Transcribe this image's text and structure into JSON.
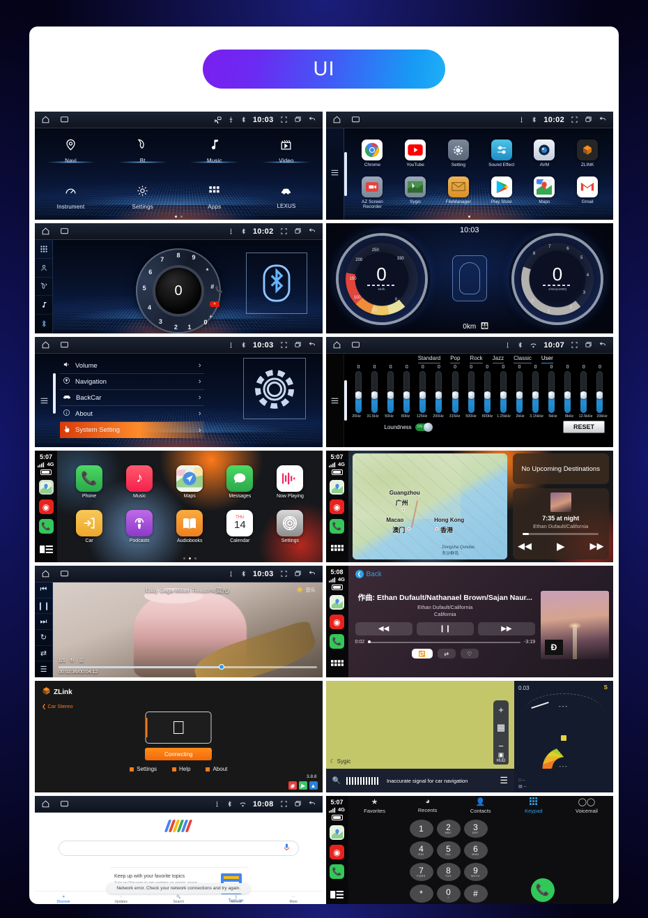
{
  "header": {
    "title": "UI"
  },
  "panels": {
    "home": {
      "statusbar": {
        "time": "10:03",
        "icons": [
          "home-icon",
          "screen-icon",
          "cast-icon",
          "usb-icon",
          "bluetooth-icon",
          "fullscreen-icon",
          "recents-icon",
          "back-icon"
        ]
      },
      "row1": [
        {
          "label": "Navi",
          "icon": "location-pin-icon"
        },
        {
          "label": "Bt",
          "icon": "phone-handset-icon"
        },
        {
          "label": "Music",
          "icon": "music-note-icon"
        },
        {
          "label": "Video",
          "icon": "clapperboard-icon"
        }
      ],
      "row2": [
        {
          "label": "Instrument",
          "icon": "speedometer-icon"
        },
        {
          "label": "Settings",
          "icon": "gear-icon"
        },
        {
          "label": "Apps",
          "icon": "app-grid-icon"
        },
        {
          "label": "LEXUS",
          "icon": "car-icon"
        }
      ]
    },
    "drawer": {
      "statusbar": {
        "time": "10:02"
      },
      "row1": [
        {
          "label": "Chrome",
          "glyph": "◉",
          "bg": "#ffffff",
          "fg": "#4285f4"
        },
        {
          "label": "YouTube",
          "glyph": "▶",
          "bg": "#ffffff",
          "fg": "#ff0000"
        },
        {
          "label": "Setting",
          "glyph": "⚙",
          "bg": "#6c7a92",
          "fg": "#e8eef8"
        },
        {
          "label": "Sound Effect",
          "glyph": "≡",
          "bg": "#2ba7d6",
          "fg": "#ffffff"
        },
        {
          "label": "AVM",
          "glyph": "◎",
          "bg": "#dfe6ef",
          "fg": "#16314f"
        },
        {
          "label": "ZLINK",
          "glyph": "🦊",
          "bg": "#2b2b2b",
          "fg": "#ff8c1a"
        }
      ],
      "row2": [
        {
          "label": "AZ Screen Recorder",
          "glyph": "▣",
          "bg": "#9aa7b8",
          "fg": "#e8403a"
        },
        {
          "label": "Sygic",
          "glyph": "▰",
          "bg": "#8e9aa8",
          "fg": "#3b7d3b"
        },
        {
          "label": "FileManager",
          "glyph": "✉",
          "bg": "#e8a33d",
          "fg": "#7a5310"
        },
        {
          "label": "Play Store",
          "glyph": "▶",
          "bg": "#ffffff",
          "fg": "#00c2ff"
        },
        {
          "label": "Maps",
          "glyph": "◈",
          "bg": "#ffffff",
          "fg": "#34a853"
        },
        {
          "label": "Gmail",
          "glyph": "M",
          "bg": "#ffffff",
          "fg": "#ea4335"
        }
      ]
    },
    "bluetooth": {
      "statusbar": {
        "time": "10:02"
      },
      "rail": [
        "keypad-icon",
        "contacts-icon",
        "call-history-icon",
        "bt-music-icon",
        "bluetooth-icon"
      ],
      "center_digit": "0",
      "dial_numbers": [
        "1",
        "2",
        "3",
        "4",
        "5",
        "6",
        "7",
        "8",
        "9",
        "*",
        "#",
        "0"
      ],
      "keys": [
        "call-button",
        "delete-button",
        "plus-button"
      ],
      "bt_tile": "bluetooth-logo"
    },
    "cluster": {
      "time": "10:03",
      "left_gauge": {
        "value": "0",
        "unit": "km/h",
        "ticks": [
          "0",
          "50",
          "100",
          "150",
          "200",
          "250",
          "330"
        ]
      },
      "right_gauge": {
        "value": "0",
        "unit": "1/min(x1000)",
        "ticks": [
          "0",
          "1",
          "2",
          "3",
          "4",
          "5",
          "6",
          "7",
          "8"
        ]
      },
      "odometer": "0km"
    },
    "settings": {
      "statusbar": {
        "time": "10:03"
      },
      "items": [
        {
          "label": "Volume",
          "icon": "volume-icon"
        },
        {
          "label": "Navigation",
          "icon": "navigation-icon"
        },
        {
          "label": "BackCar",
          "icon": "car-icon"
        },
        {
          "label": "About",
          "icon": "info-icon"
        },
        {
          "label": "System Setting",
          "icon": "hand-pointer-icon"
        }
      ],
      "active_index": 4
    },
    "equalizer": {
      "statusbar": {
        "time": "10:07"
      },
      "presets": [
        "Standard",
        "Pop",
        "Rock",
        "Jazz",
        "Classic",
        "User"
      ],
      "selected_preset": "User",
      "frequencies": [
        "20Hz",
        "31.5Hz",
        "50Hz",
        "80Hz",
        "125Hz",
        "200Hz",
        "315Hz",
        "500Hz",
        "800Hz",
        "1.25kHz",
        "2kHz",
        "3.15kHz",
        "5kHz",
        "8kHz",
        "12.5kHz",
        "20kHz"
      ],
      "values": [
        0,
        0,
        0,
        0,
        0,
        0,
        0,
        0,
        0,
        0,
        0,
        0,
        0,
        0,
        0,
        0
      ],
      "loudness_label": "Loundness",
      "loudness_state": "ON",
      "reset_label": "RESET"
    },
    "carplay_home": {
      "time": "5:07",
      "network": "4G",
      "row1": [
        {
          "label": "Phone",
          "glyph": "📞",
          "bg": "#34c759"
        },
        {
          "label": "Music",
          "glyph": "♪",
          "bg": "#fa2b56"
        },
        {
          "label": "Maps",
          "glyph": "➤",
          "bg": "#e8f3df"
        },
        {
          "label": "Messages",
          "glyph": "💬",
          "bg": "#34c759"
        },
        {
          "label": "Now Playing",
          "glyph": "〉〉",
          "bg": "#ffffff"
        }
      ],
      "row2": [
        {
          "label": "Car",
          "glyph": "➡",
          "bg": "#f5b73d"
        },
        {
          "label": "Podcasts",
          "glyph": "◉",
          "bg": "#a24fd6"
        },
        {
          "label": "Audiobooks",
          "glyph": "📖",
          "bg": "#f59a2b"
        },
        {
          "label": "Calendar",
          "glyph": "14",
          "bg": "#ffffff",
          "sub": "THU"
        },
        {
          "label": "Settings",
          "glyph": "◎",
          "bg": "#9b9b9b"
        }
      ]
    },
    "carplay_maps": {
      "time": "5:07",
      "network": "4G",
      "destinations_title": "No Upcoming Destinations",
      "map_labels": [
        {
          "name": "Guangzhou",
          "cn": "广州"
        },
        {
          "name": "Hong Kong",
          "cn": "香港"
        },
        {
          "name": "Macao",
          "cn": "澳门"
        },
        {
          "name": "Dongsha Qundao",
          "cn": "东沙群岛"
        }
      ],
      "now_playing": {
        "title": "7:35 at night",
        "artist": "Ethan Dufault/California"
      },
      "controls": [
        "rewind-button",
        "play-button",
        "forward-button"
      ]
    },
    "video": {
      "statusbar": {
        "time": "10:03"
      },
      "rail": [
        "previous-icon",
        "pause-icon",
        "next-icon",
        "repeat-icon",
        "shuffle-icon",
        "playlist-icon"
      ],
      "title": "Lady Gaga-Million Reasons(蓝光)",
      "badge": "音乐",
      "index": "1/1",
      "time": "00:02:36/00:04:12"
    },
    "carplay_music": {
      "time": "5:08",
      "network": "4G",
      "back_label": "Back",
      "composer": "作曲: Ethan Dufault/Nathanael Brown/Sajan Naur...",
      "artist": "Ethan Dufault/California",
      "album": "California",
      "elapsed": "0:02",
      "remaining": "-3:19",
      "controls": [
        "rewind-button",
        "pause-button",
        "forward-button"
      ],
      "secondary": [
        "repeat-button",
        "shuffle-button",
        "favorite-button"
      ]
    },
    "zlink": {
      "brand": "ZLink",
      "back_label": "Car Stereo",
      "device_icon": "apple-logo-icon",
      "status_button": "Connecting",
      "links": [
        "Settings",
        "Help",
        "About"
      ],
      "version": "3.8.8"
    },
    "sygic": {
      "brand": "Sygic",
      "message": "Inaccurate signal for car navigation",
      "hud_label": "HUD",
      "zoom_in": "+",
      "zoom_out": "−",
      "side_speed": "0.03",
      "side_gear": "S"
    },
    "google": {
      "statusbar": {
        "time": "10:08"
      },
      "search_placeholder": "",
      "card_title": "Keep up with your favorite topics",
      "card_sub": "Turn on Discover to get updates on sports, music, movies, and more",
      "card_action": "Turn on",
      "toast": "Network error. Check your network connections and try again.",
      "nav": [
        {
          "label": "Discover",
          "icon": "discover-icon"
        },
        {
          "label": "Updates",
          "icon": "updates-icon"
        },
        {
          "label": "Search",
          "icon": "search-icon"
        },
        {
          "label": "Recent",
          "icon": "recent-icon"
        },
        {
          "label": "More",
          "icon": "more-icon"
        }
      ]
    },
    "keypad": {
      "time": "5:07",
      "network": "4G",
      "tabs": [
        {
          "label": "Favorites",
          "icon": "star-icon"
        },
        {
          "label": "Recents",
          "icon": "clock-icon"
        },
        {
          "label": "Contacts",
          "icon": "person-icon"
        },
        {
          "label": "Keypad",
          "icon": "keypad-icon"
        },
        {
          "label": "Voicemail",
          "icon": "voicemail-icon"
        }
      ],
      "active_tab": "Keypad",
      "keys": [
        {
          "d": "1",
          "s": ""
        },
        {
          "d": "2",
          "s": "ABC"
        },
        {
          "d": "3",
          "s": "DEF"
        },
        {
          "d": "4",
          "s": "GHI"
        },
        {
          "d": "5",
          "s": "JKL"
        },
        {
          "d": "6",
          "s": "MNO"
        },
        {
          "d": "7",
          "s": "PQRS"
        },
        {
          "d": "8",
          "s": "TUV"
        },
        {
          "d": "9",
          "s": "WXYZ"
        },
        {
          "d": "*",
          "s": ""
        },
        {
          "d": "0",
          "s": "+"
        },
        {
          "d": "#",
          "s": ""
        }
      ],
      "call_button": "call-button"
    }
  }
}
